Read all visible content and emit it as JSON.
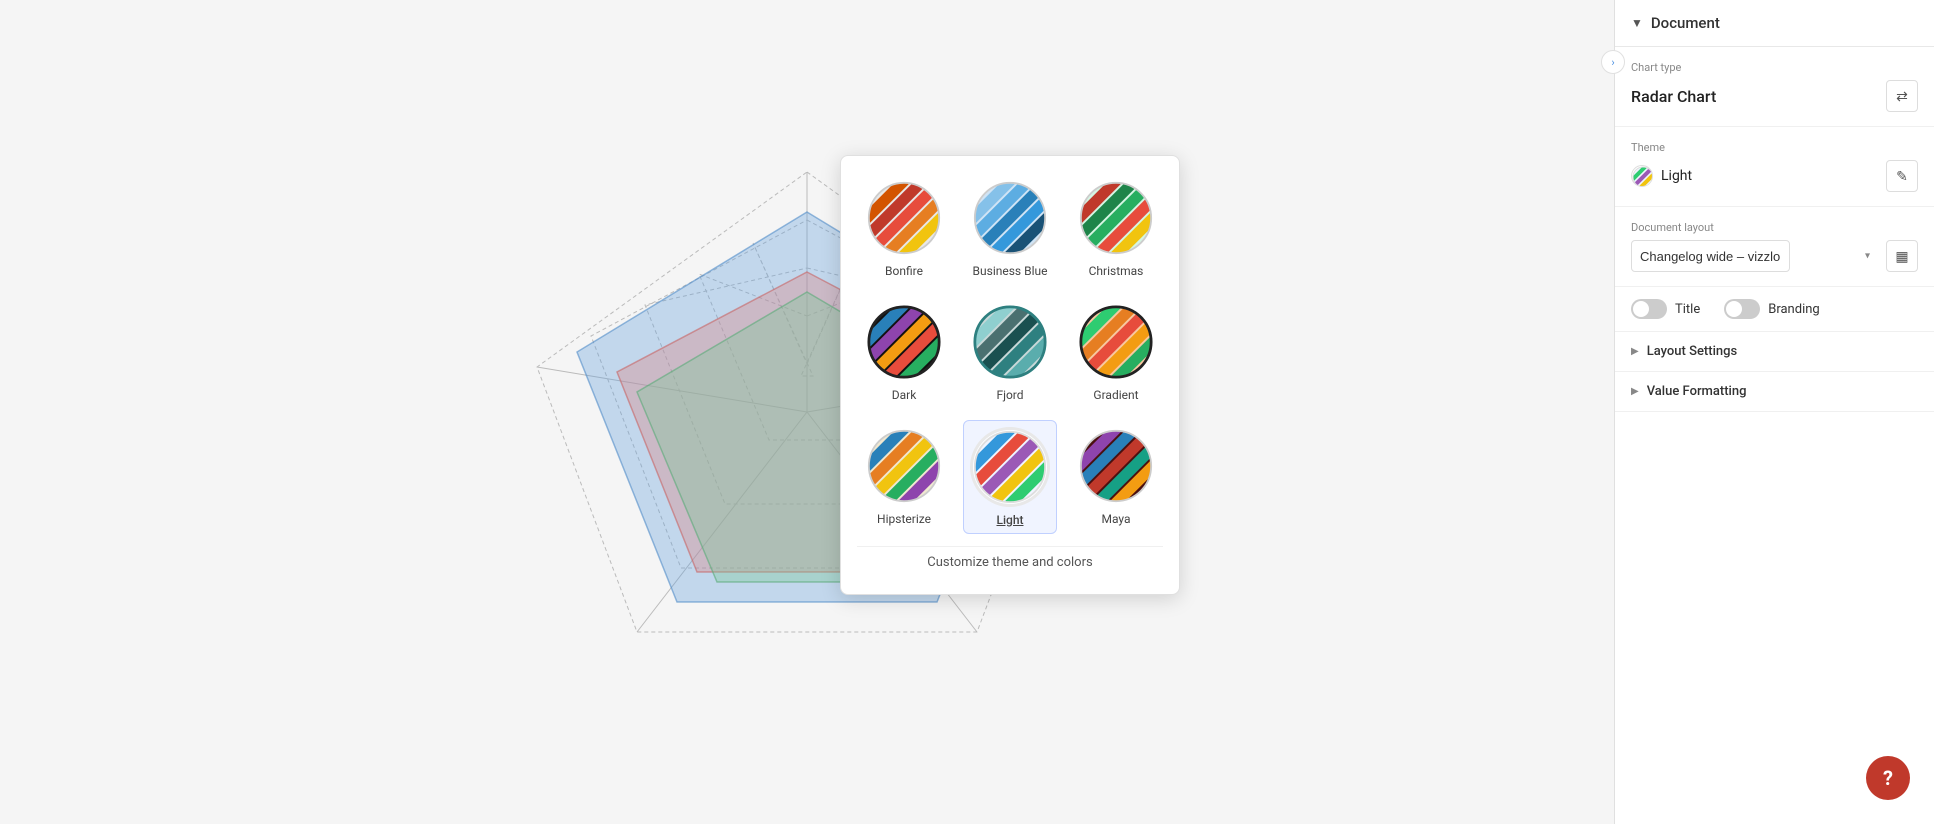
{
  "panel": {
    "document_label": "Document",
    "collapse_icon": "‹",
    "chart_type_label": "Chart type",
    "chart_type_value": "Radar Chart",
    "switch_icon": "⇄",
    "theme_label": "Theme",
    "theme_value": "Light",
    "edit_icon": "✎",
    "document_layout_label": "Document layout",
    "document_layout_value": "Changelog wide – vizzlo",
    "title_label": "Title",
    "branding_label": "Branding",
    "layout_settings_label": "Layout Settings",
    "value_formatting_label": "Value Formatting"
  },
  "themes": [
    {
      "id": "bonfire",
      "label": "Bonfire",
      "selected": false
    },
    {
      "id": "business-blue",
      "label": "Business Blue",
      "selected": false
    },
    {
      "id": "christmas",
      "label": "Christmas",
      "selected": false
    },
    {
      "id": "dark",
      "label": "Dark",
      "selected": false
    },
    {
      "id": "fjord",
      "label": "Fjord",
      "selected": false
    },
    {
      "id": "gradient",
      "label": "Gradient",
      "selected": false
    },
    {
      "id": "hipsterize",
      "label": "Hipsterize",
      "selected": false
    },
    {
      "id": "light",
      "label": "Light",
      "selected": true
    },
    {
      "id": "maya",
      "label": "Maya",
      "selected": false
    }
  ],
  "customize_label": "Customize theme and colors",
  "help_label": "?"
}
